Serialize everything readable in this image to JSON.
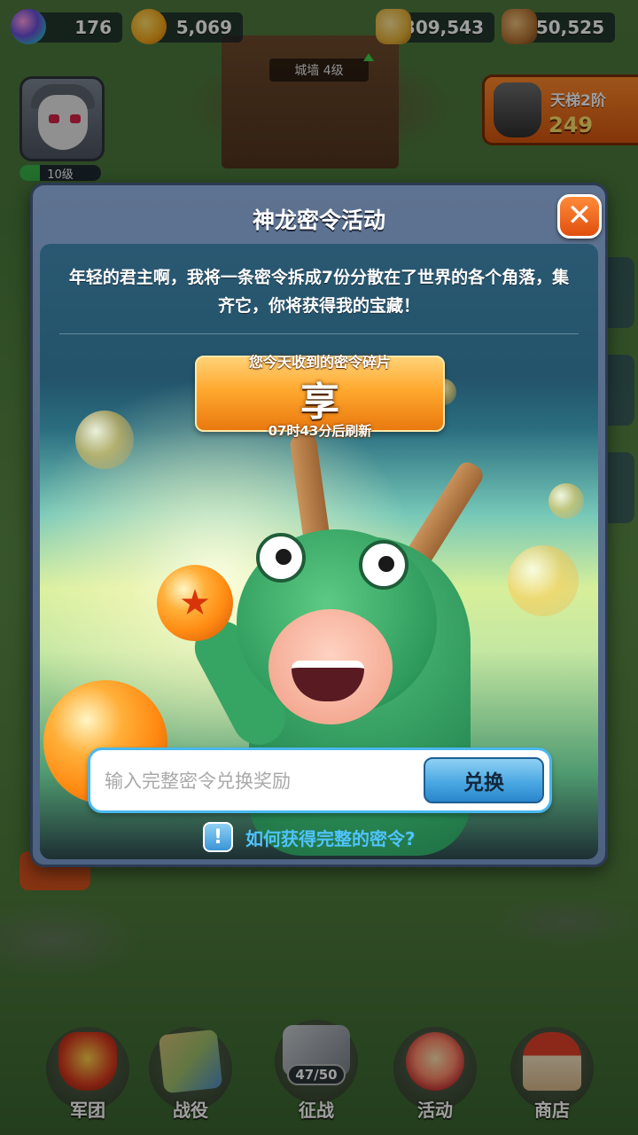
{
  "resources": {
    "gems": "176",
    "gold": "5,069",
    "grain": "309,543",
    "wood": "50,525"
  },
  "wall": {
    "label": "城墙 4级"
  },
  "player": {
    "level_label": "10级",
    "level_progress": 0.25
  },
  "ladder": {
    "title": "天梯2阶",
    "value": "249"
  },
  "modal": {
    "title": "神龙密令活动",
    "intro": "年轻的君主啊，我将一条密令拆成7份分散在了世界的各个角落，集齐它，你将获得我的宝藏！",
    "fragment_label": "您今天收到的密令碎片",
    "fragment_char": "享",
    "refresh_text": "07时43分后刷新",
    "input_placeholder": "输入完整密令兑换奖励",
    "input_value": "",
    "redeem_label": "兑换",
    "help_icon": "!",
    "help_text": "如何获得完整的密令?"
  },
  "bottom_nav": {
    "items": [
      {
        "label": "军团",
        "icon": "legion-icon"
      },
      {
        "label": "战役",
        "icon": "map-icon"
      },
      {
        "label": "征战",
        "icon": "crossed-swords-icon",
        "badge": "47/50"
      },
      {
        "label": "活动",
        "icon": "event-icon"
      },
      {
        "label": "商店",
        "icon": "shop-icon"
      }
    ]
  },
  "colors": {
    "accent_orange": "#ff8a2b",
    "button_blue": "#4aa8e2",
    "help_link": "#4fc3ff",
    "modal_bg": "#5e7391"
  }
}
